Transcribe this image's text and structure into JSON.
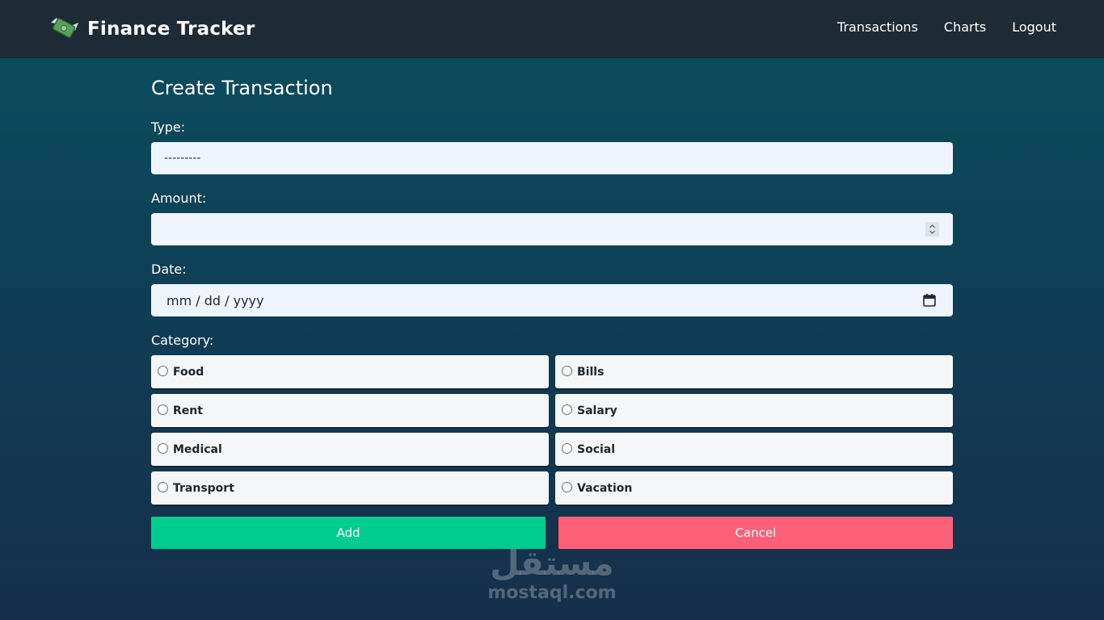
{
  "nav": {
    "brand": "Finance Tracker",
    "links": [
      "Transactions",
      "Charts",
      "Logout"
    ]
  },
  "form": {
    "title": "Create Transaction",
    "type_label": "Type:",
    "type_value": "---------",
    "amount_label": "Amount:",
    "amount_value": "",
    "date_label": "Date:",
    "date_placeholder": "mm / dd / yyyy",
    "category_label": "Category:",
    "categories": [
      "Food",
      "Bills",
      "Rent",
      "Salary",
      "Medical",
      "Social",
      "Transport",
      "Vacation"
    ],
    "add_label": "Add",
    "cancel_label": "Cancel"
  },
  "watermark": {
    "arabic": "مستقل",
    "latin": "mostaql.com"
  },
  "colors": {
    "navbar": "#1d2b36",
    "add_button": "#00cc8f",
    "cancel_button": "#ff6078",
    "input_background": "#eef5ff"
  },
  "icons": {
    "brand": "money-with-wings-icon",
    "amount": "spinner-icon",
    "date": "calendar-icon"
  }
}
